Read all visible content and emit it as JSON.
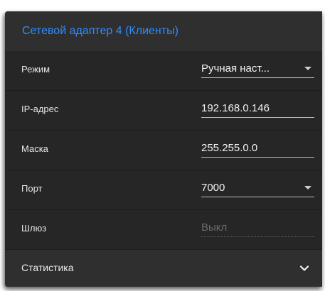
{
  "header": {
    "title": "Сетевой адаптер 4 (Клиенты)",
    "accent_color": "#2f8cff"
  },
  "fields": [
    {
      "label": "Режим",
      "value": "Ручная наст...",
      "type": "dropdown"
    },
    {
      "label": "IP-адрес",
      "value": "192.168.0.146",
      "type": "text"
    },
    {
      "label": "Маска",
      "value": "255.255.0.0",
      "type": "text"
    },
    {
      "label": "Порт",
      "value": "7000",
      "type": "dropdown"
    },
    {
      "label": "Шлюз",
      "placeholder": "Выкл",
      "type": "text-disabled"
    }
  ],
  "statistics": {
    "label": "Статистика",
    "icon": "chevron-down-icon"
  }
}
